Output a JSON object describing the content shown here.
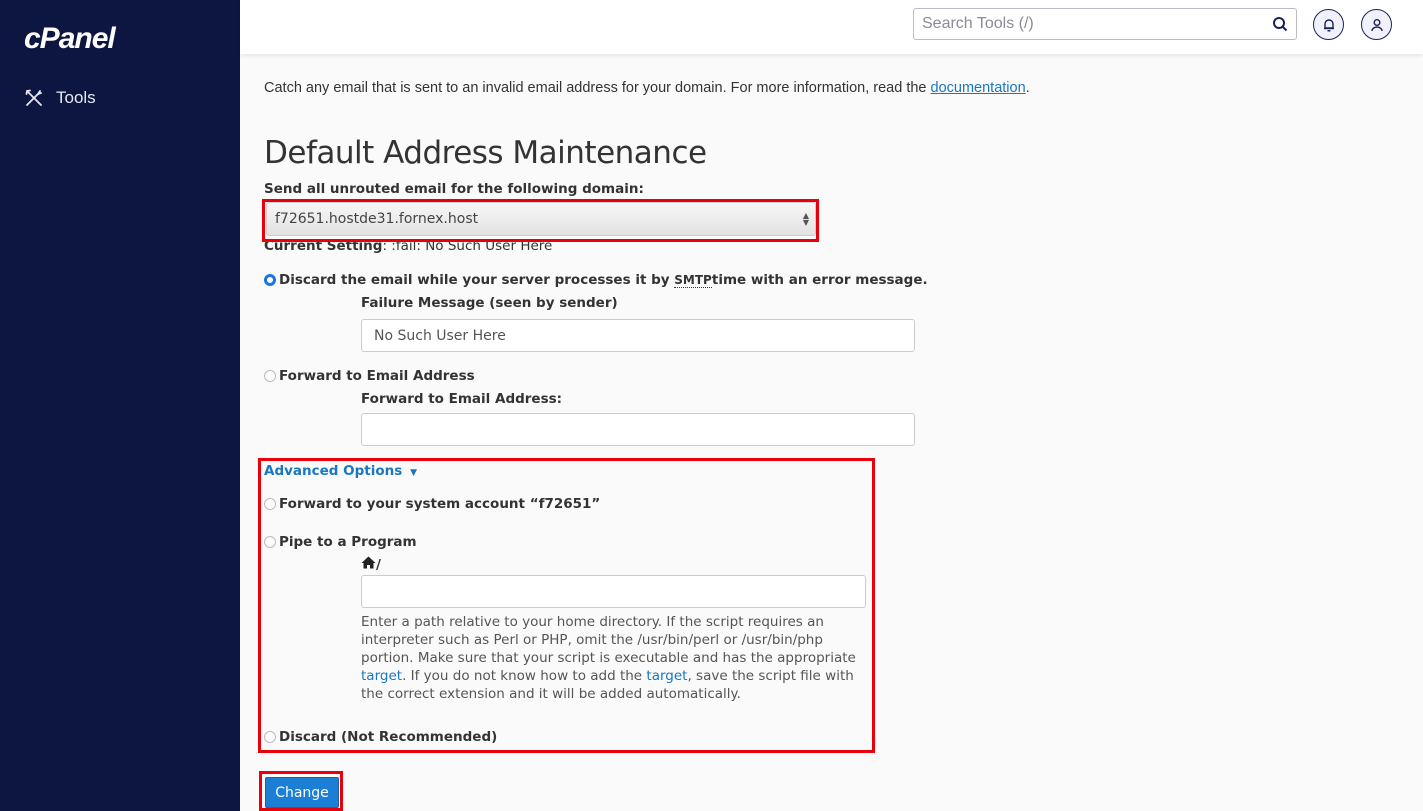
{
  "sidebar": {
    "logo": "cPanel",
    "items": [
      {
        "label": "Tools",
        "icon": "tools-icon"
      }
    ]
  },
  "topbar": {
    "search_placeholder": "Search Tools (/)",
    "search_icon": "search-icon",
    "notifications_icon": "bell-icon",
    "user_icon": "user-icon"
  },
  "page": {
    "intro_text": "Catch any email that is sent to an invalid email address for your domain. For more information, read the ",
    "intro_link": "documentation",
    "intro_end": ".",
    "title": "Default Address Maintenance",
    "domain_label": "Send all unrouted email for the following domain:",
    "domain_selected": "f72651.hostde31.fornex.host",
    "current_setting_label": "Current Setting",
    "current_setting_value": ": :fail: No Such User Here",
    "options": {
      "discard_pre": "Discard the email while your server processes it by ",
      "discard_abbr": "SMTP",
      "discard_post": " time with an error message.",
      "failure_label": "Failure Message (seen by sender)",
      "failure_value": "No Such User Here",
      "forward_label": "Forward to Email Address",
      "forward_field_label": "Forward to Email Address:",
      "forward_value": ""
    },
    "advanced": {
      "toggle_label": "Advanced Options",
      "system_account": "Forward to your system account “f72651”",
      "pipe_label": "Pipe to a Program",
      "pipe_prefix": "/",
      "pipe_value": "",
      "help_1": "Enter a path relative to your home directory. If the script requires an interpreter such as Perl or PHP, omit the /usr/bin/perl or /usr/bin/php portion. Make sure that your script is executable and has the appropriate ",
      "help_link1": "target",
      "help_2": ". If you do not know how to add the ",
      "help_link2": "target",
      "help_3": ", save the script file with the correct extension and it will be added automatically.",
      "discard_label": "Discard (Not Recommended)"
    },
    "selected_option": "discard_smtp",
    "submit_label": "Change"
  },
  "colors": {
    "sidebar_bg": "#0c1640",
    "link": "#1977c2",
    "button": "#1b7fd6",
    "highlight": "#e8000b"
  }
}
